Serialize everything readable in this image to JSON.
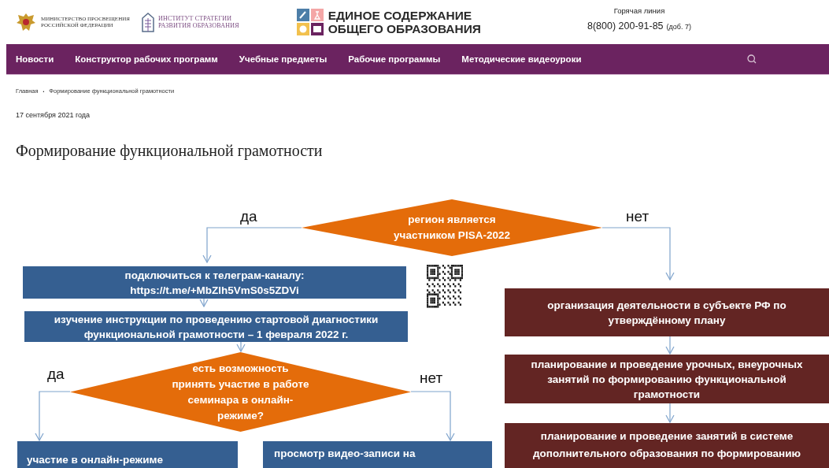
{
  "header": {
    "ministry_logo": {
      "text": "МИНИСТЕРСТВО ПРОСВЕЩЕНИЯ\nРОССИЙСКОЙ ФЕДЕРАЦИИ"
    },
    "institute_logo": {
      "text": "ИНСТИТУТ СТРАТЕГИИ\nРАЗВИТИЯ ОБРАЗОВАНИЯ"
    },
    "site_logo": {
      "text": "ЕДИНОЕ СОДЕРЖАНИЕ\nОБЩЕГО ОБРАЗОВАНИЯ"
    },
    "hotline": {
      "label": "Горячая линия",
      "phone": "8(800) 200-91-85",
      "extension": "(доб. 7)"
    }
  },
  "nav": {
    "items": [
      {
        "label": "Новости"
      },
      {
        "label": "Конструктор рабочих программ"
      },
      {
        "label": "Учебные предметы"
      },
      {
        "label": "Рабочие программы"
      },
      {
        "label": "Методические видеоуроки"
      }
    ]
  },
  "breadcrumbs": {
    "separator": "•",
    "items": [
      "Главная",
      "Формирование функциональной грамотности"
    ]
  },
  "date": "17 сентября 2021 года",
  "title": "Формирование функциональной грамотности",
  "flowchart": {
    "nodes": [
      {
        "kind": "decision",
        "text": "регион является\nучастником PISA-2022"
      },
      {
        "kind": "process",
        "color": "#355f91",
        "text": "подключиться к телеграм-каналу:\nhttps://t.me/+MbZlh5VmS0s5ZDVi"
      },
      {
        "kind": "process",
        "color": "#355f91",
        "text": "изучение инструкции по проведению стартовой диагностики\nфункциональной грамотности – 1 февраля 2022 г."
      },
      {
        "kind": "decision",
        "text": "есть возможность\nпринять участие в работе\nсеминара в онлайн-\nрежиме?"
      },
      {
        "kind": "process",
        "color": "#355f91",
        "text": "участие в онлайн-режиме"
      },
      {
        "kind": "process",
        "color": "#355f91",
        "text": "просмотр видео-записи на"
      },
      {
        "kind": "process",
        "color": "#632523",
        "text": "организация деятельности в субъекте РФ по\nутверждённому плану"
      },
      {
        "kind": "process",
        "color": "#632523",
        "text": "планирование и проведение урочных, внеурочных\nзанятий по формированию функциональной\nграмотности"
      },
      {
        "kind": "process",
        "color": "#632523",
        "text": "планирование и проведение занятий в системе\nдополнительного образования по формированию"
      }
    ],
    "branch_labels": [
      "да",
      "нет",
      "да",
      "нет"
    ]
  }
}
